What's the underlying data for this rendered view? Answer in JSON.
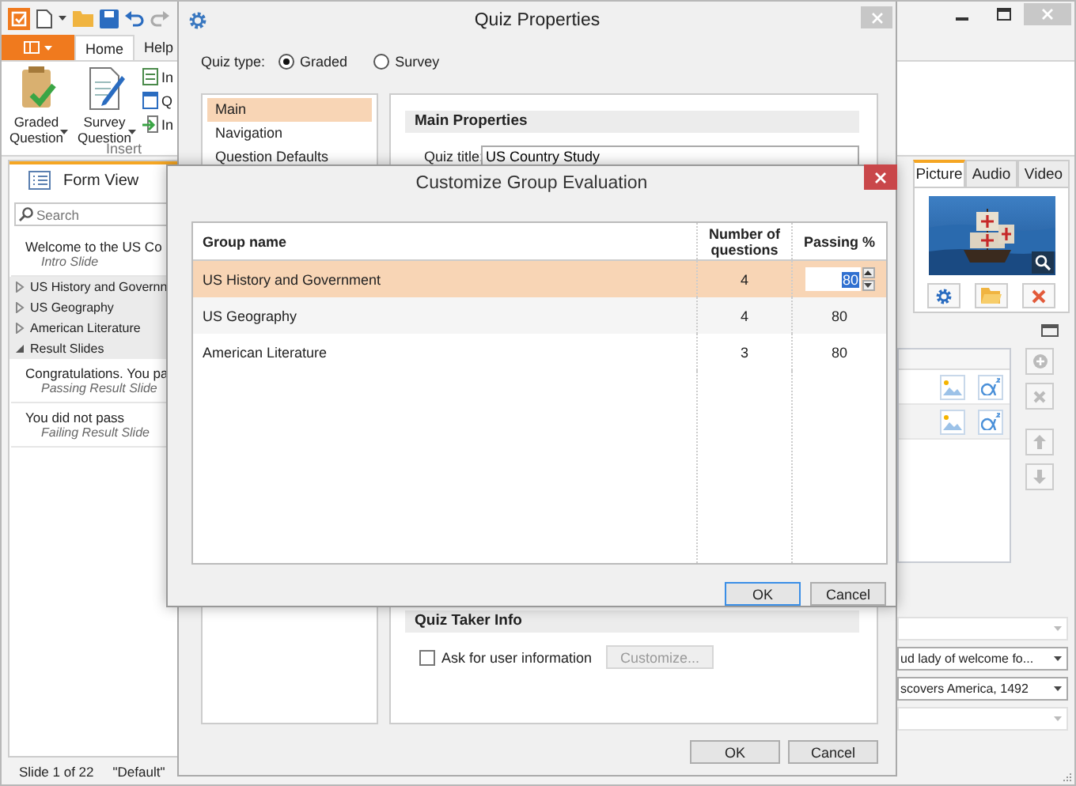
{
  "ribbon": {
    "tabs": [
      {
        "label": "Home",
        "selected": true
      },
      {
        "label": "Help",
        "selected": false
      }
    ],
    "large_buttons": [
      {
        "kind": "graded",
        "label": "Graded Question"
      },
      {
        "kind": "survey",
        "label": "Survey Question"
      }
    ],
    "small_items": [
      {
        "kind": "insert",
        "label": "In"
      },
      {
        "kind": "question",
        "label": "Q"
      },
      {
        "kind": "import",
        "label": "In"
      }
    ],
    "group_label": "Insert"
  },
  "form_view": {
    "tab": "Form View",
    "search_placeholder": "Search",
    "items": [
      {
        "kind": "slide",
        "title": "Welcome to the US Co",
        "subtitle": "Intro Slide"
      },
      {
        "kind": "group",
        "label": "US History and Governn",
        "expanded": false
      },
      {
        "kind": "group",
        "label": "US Geography",
        "expanded": false
      },
      {
        "kind": "group",
        "label": "American Literature",
        "expanded": false
      },
      {
        "kind": "group",
        "label": "Result Slides",
        "expanded": true,
        "children": [
          {
            "kind": "slide",
            "title": "Congratulations. You pa",
            "subtitle": "Passing Result Slide"
          },
          {
            "kind": "slide",
            "title": "You did not pass",
            "subtitle": "Failing Result Slide"
          }
        ]
      }
    ]
  },
  "status_bar": [
    "Slide 1 of 22",
    "\"Default\""
  ],
  "media_tabs": [
    {
      "label": "Picture",
      "selected": true
    },
    {
      "label": "Audio",
      "selected": false
    },
    {
      "label": "Video",
      "selected": false
    }
  ],
  "dropdowns": [
    {
      "disabled": true
    },
    {
      "value": "ud lady of welcome fo...",
      "disabled": false
    },
    {
      "value": "scovers America, 1492",
      "disabled": false
    },
    {
      "disabled": true
    }
  ],
  "quiz_properties": {
    "title": "Quiz Properties",
    "quiz_type_label": "Quiz type:",
    "quiz_types": [
      {
        "label": "Graded",
        "selected": true
      },
      {
        "label": "Survey",
        "selected": false
      }
    ],
    "nav": [
      {
        "label": "Main",
        "selected": true
      },
      {
        "label": "Navigation",
        "selected": false
      },
      {
        "label": "Question Defaults",
        "selected": false
      }
    ],
    "section_title": "Main Properties",
    "quiz_title_label": "Quiz title:",
    "quiz_title": "US Country Study",
    "taker_section": "Quiz Taker Info",
    "ask_user_info": {
      "label": "Ask for user information",
      "checked": false
    },
    "customize_button": {
      "label": "Customize...",
      "disabled": true
    },
    "buttons": [
      "OK",
      "Cancel"
    ]
  },
  "group_evaluation": {
    "title": "Customize Group Evaluation",
    "columns": [
      "Group name",
      "Number of questions",
      "Passing %"
    ],
    "rows": [
      {
        "name": "US History and Government",
        "questions": "4",
        "passing": "80",
        "selected": true,
        "editing": true
      },
      {
        "name": "US Geography",
        "questions": "4",
        "passing": "80",
        "selected": false,
        "editing": false
      },
      {
        "name": "American Literature",
        "questions": "3",
        "passing": "80",
        "selected": false,
        "editing": false
      }
    ],
    "buttons": [
      "OK",
      "Cancel"
    ]
  }
}
